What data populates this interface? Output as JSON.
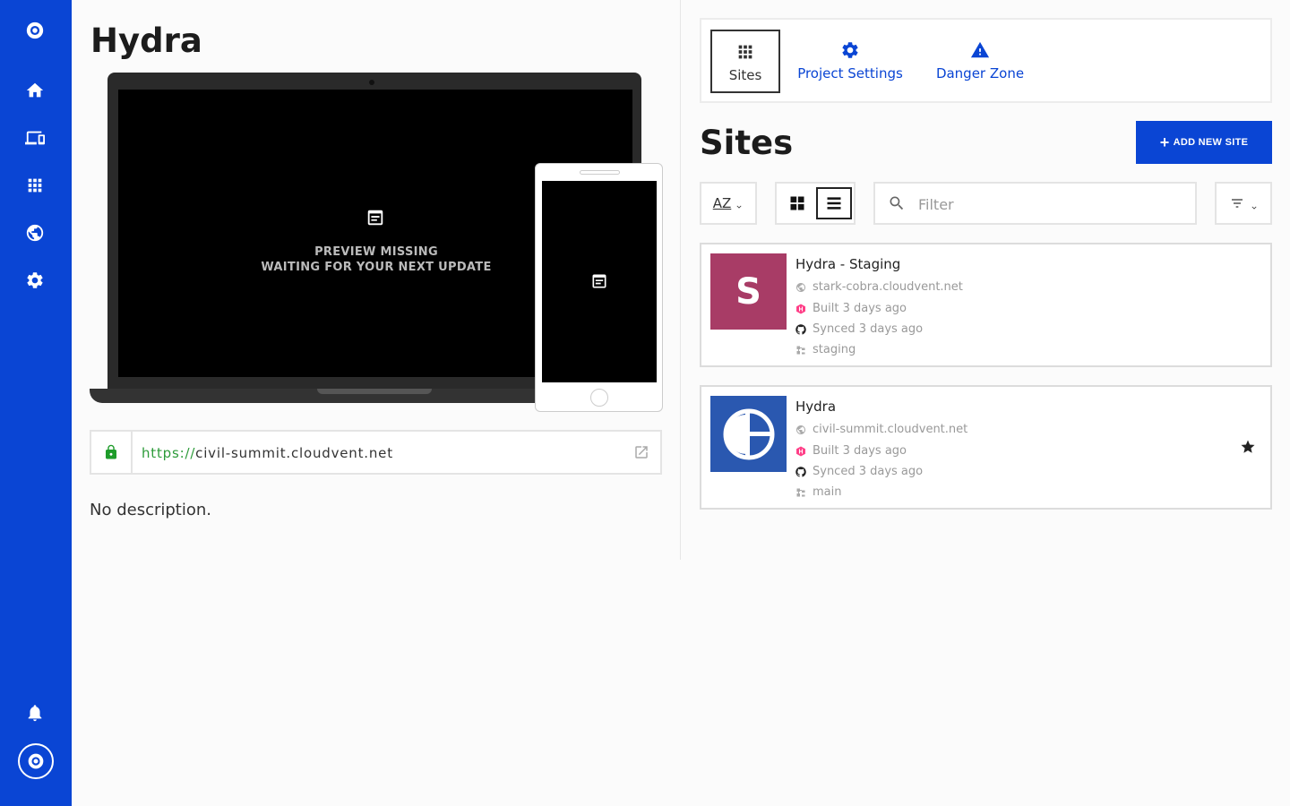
{
  "project": {
    "title": "Hydra",
    "preview_line1": "PREVIEW MISSING",
    "preview_line2": "WAITING FOR YOUR NEXT UPDATE",
    "url_protocol": "https://",
    "url_host": "civil-summit.cloudvent.net",
    "description": "No description."
  },
  "tabs": [
    {
      "label": "Sites",
      "icon": "grid-dots-icon"
    },
    {
      "label": "Project Settings",
      "icon": "gear-icon"
    },
    {
      "label": "Danger Zone",
      "icon": "warning-icon"
    }
  ],
  "sites_section": {
    "title": "Sites",
    "add_button_label": "ADD NEW SITE",
    "filter_placeholder": "Filter",
    "sort_label": "AZ"
  },
  "sites": [
    {
      "name": "Hydra - Staging",
      "thumb_letter": "S",
      "domain": "stark-cobra.cloudvent.net",
      "built": "Built 3 days ago",
      "synced": "Synced 3 days ago",
      "branch": "staging",
      "starred": false
    },
    {
      "name": "Hydra",
      "domain": "civil-summit.cloudvent.net",
      "built": "Built 3 days ago",
      "synced": "Synced 3 days ago",
      "branch": "main",
      "starred": true
    }
  ],
  "colors": {
    "brand": "#0a45d4",
    "staging_thumb": "#a83c66",
    "lock_green": "#1e9c2a"
  }
}
